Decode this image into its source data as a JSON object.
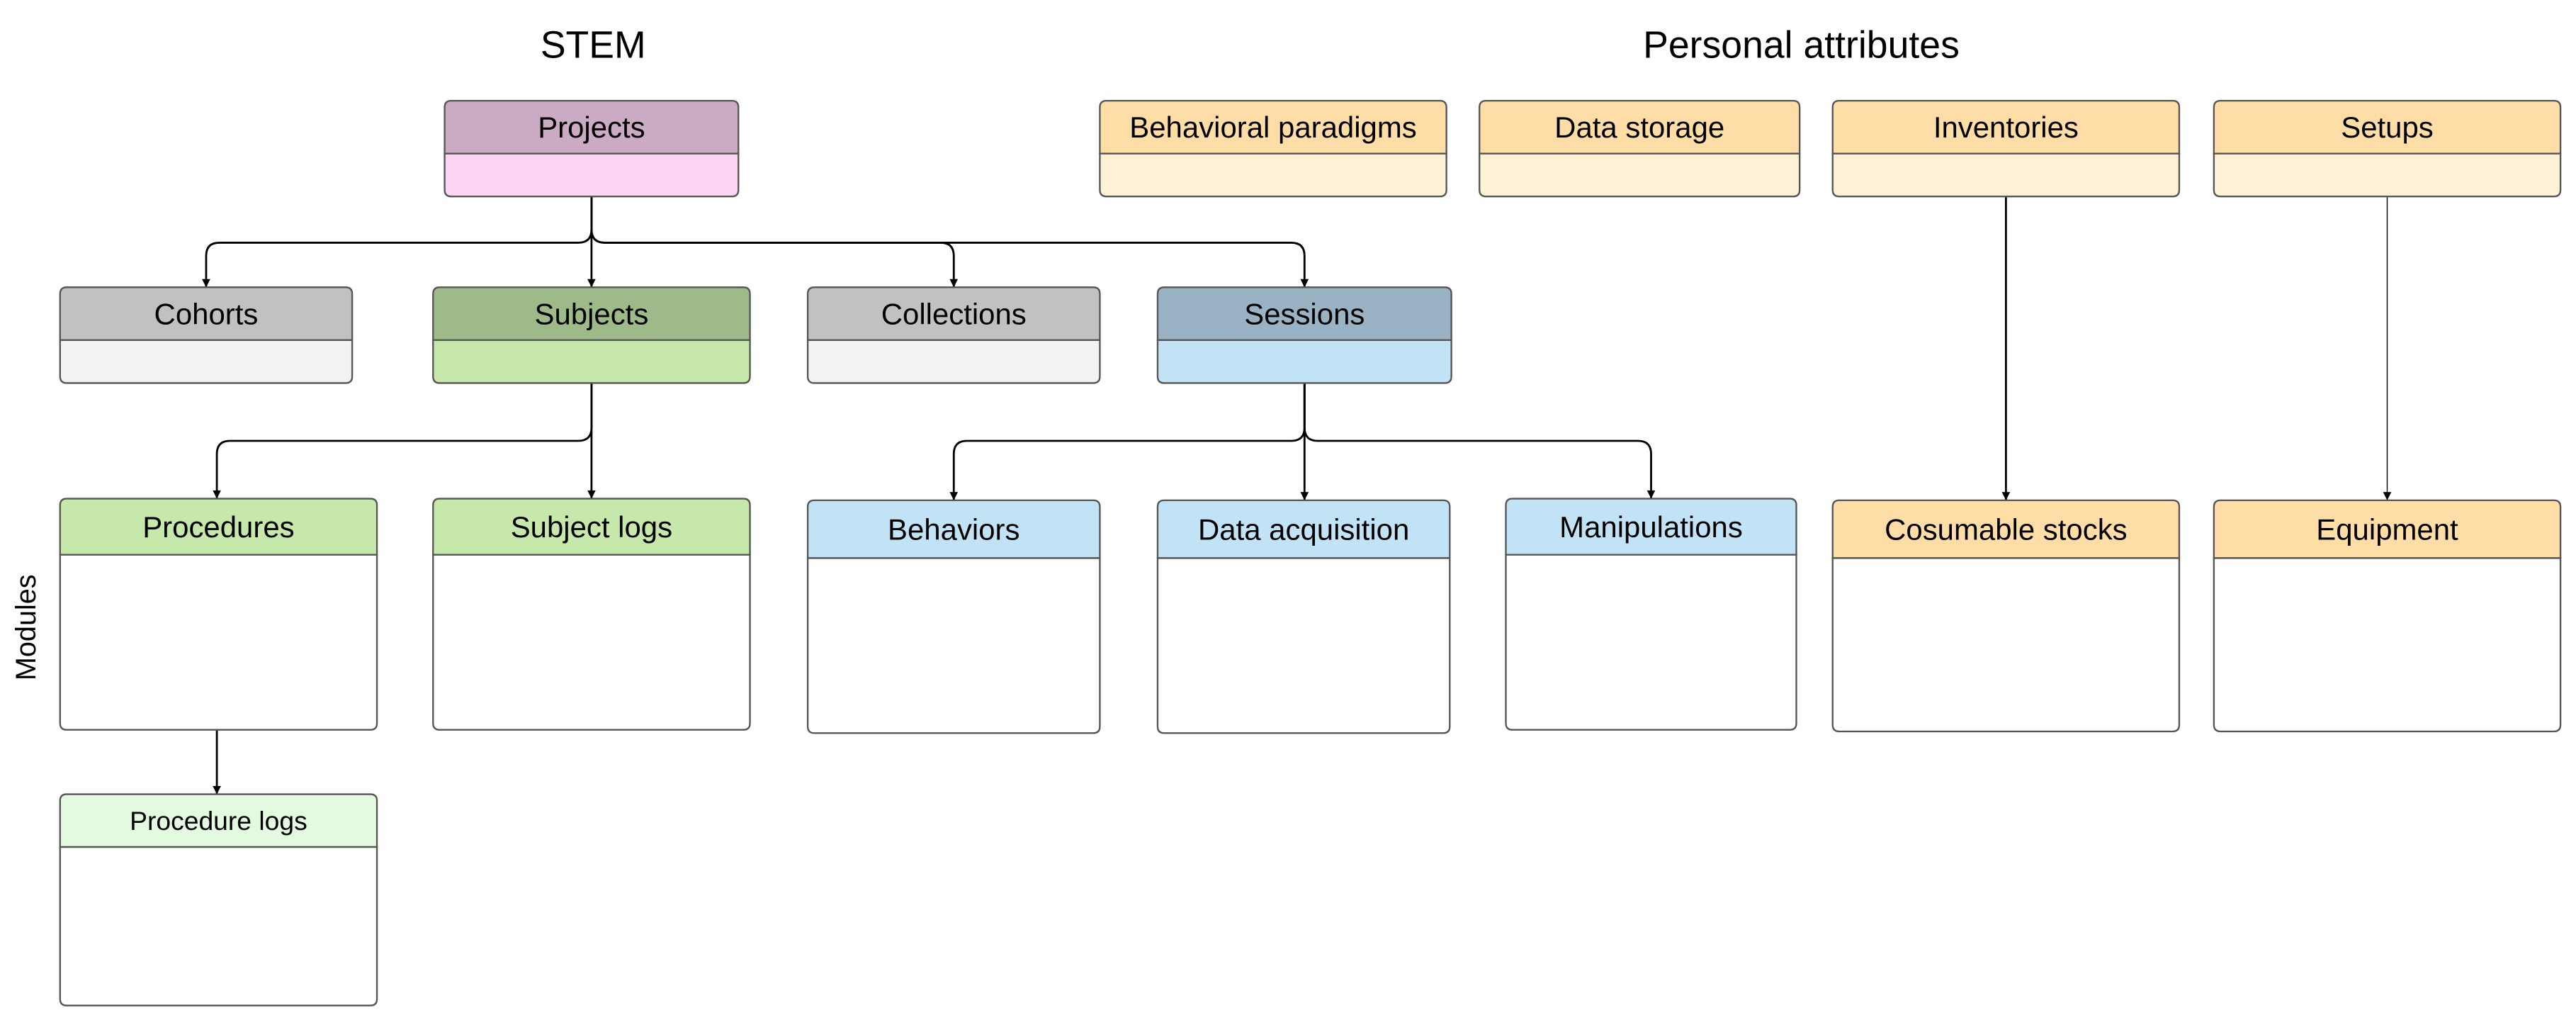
{
  "titles": {
    "stem": "STEM",
    "personal": "Personal attributes",
    "modules": "Modules"
  },
  "boxes": [
    {
      "id": "projects",
      "label": "Projects",
      "header": "#cbabc4",
      "body": "#fdd5f4"
    },
    {
      "id": "cohorts",
      "label": "Cohorts",
      "header": "#c1c1c3",
      "body": "#f1f2f4"
    },
    {
      "id": "subjects",
      "label": "Subjects",
      "header": "#9fba89",
      "body": "#c6e8aa"
    },
    {
      "id": "collections",
      "label": "Collections",
      "header": "#c1c1c3",
      "body": "#f1f2f4"
    },
    {
      "id": "sessions",
      "label": "Sessions",
      "header": "#9ab3c4",
      "body": "#c2e3f5"
    },
    {
      "id": "behavioral-paradigms",
      "label": "Behavioral paradigms",
      "header": "#fedda6",
      "body": "#fff1d6"
    },
    {
      "id": "data-storage",
      "label": "Data storage",
      "header": "#fedda6",
      "body": "#fff1d6"
    },
    {
      "id": "inventories",
      "label": "Inventories",
      "header": "#fedda6",
      "body": "#fff1d6"
    },
    {
      "id": "setups",
      "label": "Setups",
      "header": "#fedda6",
      "body": "#fff1d6"
    },
    {
      "id": "procedures",
      "label": "Procedures",
      "header": "#c6e8aa",
      "body": "#ffffff"
    },
    {
      "id": "subject-logs",
      "label": "Subject logs",
      "header": "#c6e8aa",
      "body": "#ffffff"
    },
    {
      "id": "behaviors",
      "label": "Behaviors",
      "header": "#c2e3f5",
      "body": "#ffffff"
    },
    {
      "id": "data-acquisition",
      "label": "Data acquisition",
      "header": "#c2e3f5",
      "body": "#ffffff"
    },
    {
      "id": "manipulations",
      "label": "Manipulations",
      "header": "#c2e3f5",
      "body": "#ffffff"
    },
    {
      "id": "cosumable-stocks",
      "label": "Cosumable stocks",
      "header": "#fedda6",
      "body": "#ffffff"
    },
    {
      "id": "equipment",
      "label": "Equipment",
      "header": "#fedda6",
      "body": "#ffffff"
    },
    {
      "id": "procedure-logs",
      "label": "Procedure logs",
      "header": "#e3f9e0",
      "body": "#ffffff"
    }
  ],
  "edges": [
    {
      "from": "projects",
      "to": "cohorts"
    },
    {
      "from": "projects",
      "to": "subjects"
    },
    {
      "from": "projects",
      "to": "collections"
    },
    {
      "from": "projects",
      "to": "sessions"
    },
    {
      "from": "subjects",
      "to": "procedures"
    },
    {
      "from": "subjects",
      "to": "subject-logs"
    },
    {
      "from": "sessions",
      "to": "behaviors"
    },
    {
      "from": "sessions",
      "to": "data-acquisition"
    },
    {
      "from": "sessions",
      "to": "manipulations"
    },
    {
      "from": "procedures",
      "to": "procedure-logs"
    },
    {
      "from": "inventories",
      "to": "cosumable-stocks"
    },
    {
      "from": "setups",
      "to": "equipment"
    }
  ]
}
